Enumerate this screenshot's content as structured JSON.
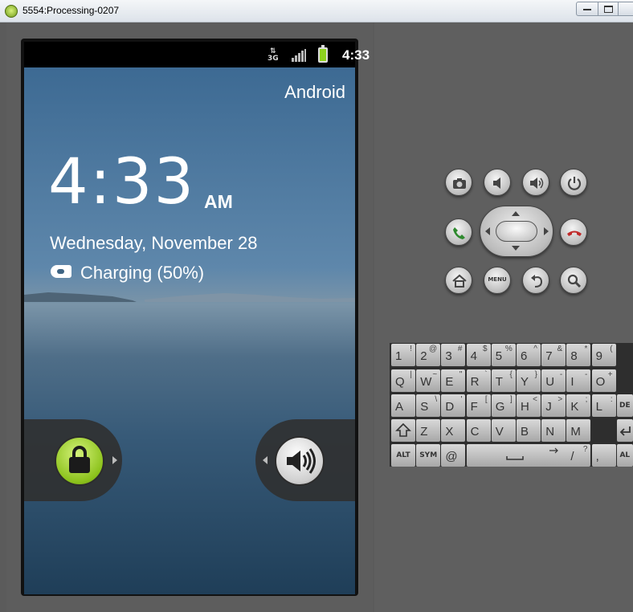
{
  "window": {
    "title": "5554:Processing-0207"
  },
  "status_bar": {
    "network": "3G",
    "time": "4:33",
    "icons": [
      "signal-icon",
      "battery-charging-icon"
    ]
  },
  "lockscreen": {
    "carrier": "Android",
    "clock": "4:33",
    "ampm": "AM",
    "date": "Wednesday, November 28",
    "charging": "Charging (50%)",
    "unlock_icon": "unlock-icon",
    "sound_icon": "speaker-icon"
  },
  "controls": {
    "row1": [
      "camera-icon",
      "volume-down-icon",
      "volume-up-icon",
      "power-icon"
    ],
    "row2": [
      "call-icon",
      "dpad",
      "end-call-icon"
    ],
    "row3": [
      "home-icon",
      "menu-button",
      "back-icon",
      "search-icon"
    ],
    "menu_label": "MENU"
  },
  "keyboard": {
    "row1": [
      {
        "k": "1",
        "a": "!"
      },
      {
        "k": "2",
        "a": "@"
      },
      {
        "k": "3",
        "a": "#"
      },
      {
        "k": "4",
        "a": "$"
      },
      {
        "k": "5",
        "a": "%"
      },
      {
        "k": "6",
        "a": "^"
      },
      {
        "k": "7",
        "a": "&"
      },
      {
        "k": "8",
        "a": "*"
      },
      {
        "k": "9",
        "a": "("
      }
    ],
    "row2": [
      {
        "k": "Q",
        "a": "|"
      },
      {
        "k": "W",
        "a": "~"
      },
      {
        "k": "E",
        "a": "\""
      },
      {
        "k": "R",
        "a": "`"
      },
      {
        "k": "T",
        "a": "{"
      },
      {
        "k": "Y",
        "a": "}"
      },
      {
        "k": "U",
        "a": "-"
      },
      {
        "k": "I",
        "a": "-"
      },
      {
        "k": "O",
        "a": "+"
      }
    ],
    "row3": [
      {
        "k": "A",
        "a": ""
      },
      {
        "k": "S",
        "a": "\\"
      },
      {
        "k": "D",
        "a": "'"
      },
      {
        "k": "F",
        "a": "["
      },
      {
        "k": "G",
        "a": "]"
      },
      {
        "k": "H",
        "a": "<"
      },
      {
        "k": "J",
        "a": ">"
      },
      {
        "k": "K",
        "a": ";"
      },
      {
        "k": "L",
        "a": ":"
      }
    ],
    "row3_end": "DE",
    "row4": [
      {
        "k": "Z",
        "a": ""
      },
      {
        "k": "X",
        "a": ""
      },
      {
        "k": "C",
        "a": ""
      },
      {
        "k": "V",
        "a": ""
      },
      {
        "k": "B",
        "a": ""
      },
      {
        "k": "N",
        "a": ""
      },
      {
        "k": "M",
        "a": ""
      }
    ],
    "row5": {
      "alt": "ALT",
      "sym": "SYM",
      "at": "@",
      "slash": "/",
      "question": "?",
      "comma": ",",
      "alt2": "AL"
    }
  }
}
